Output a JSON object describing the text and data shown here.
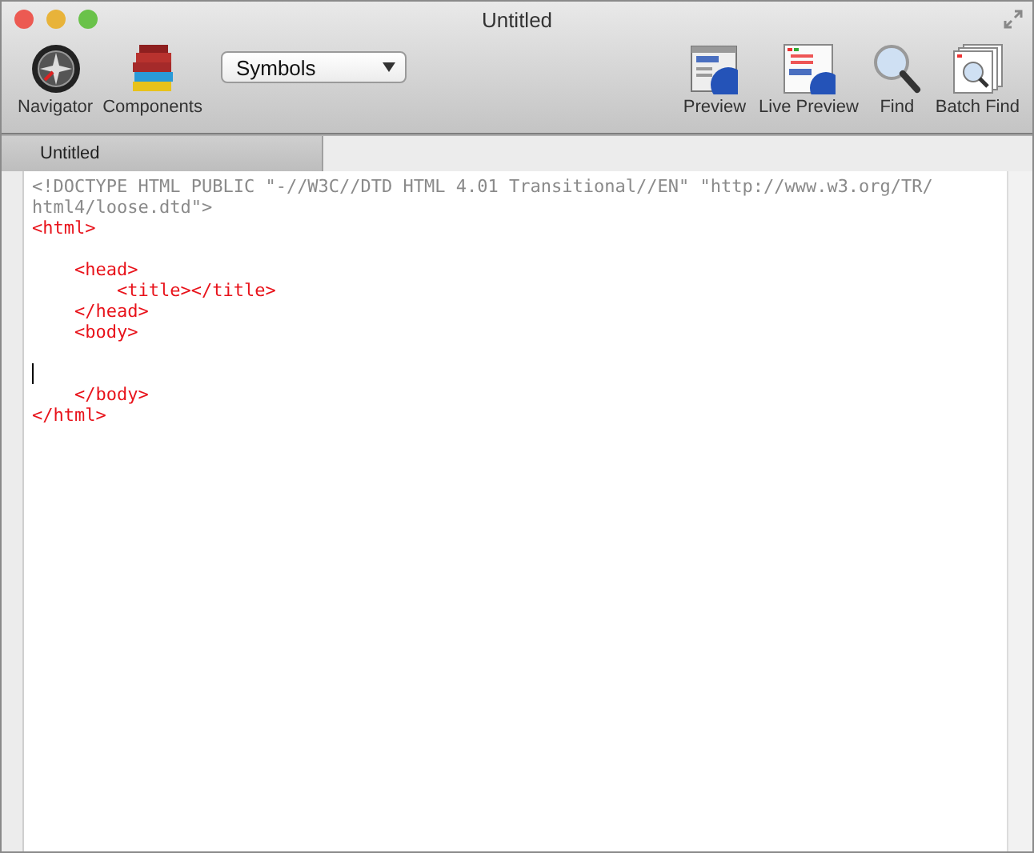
{
  "window": {
    "title": "Untitled"
  },
  "toolbar": {
    "left": [
      {
        "label": "Navigator",
        "kind": "compass"
      },
      {
        "label": "Components",
        "kind": "books"
      }
    ],
    "dropdown": {
      "value": "Symbols"
    },
    "right": [
      {
        "label": "Preview",
        "kind": "preview"
      },
      {
        "label": "Live Preview",
        "kind": "live"
      },
      {
        "label": "Find",
        "kind": "find"
      },
      {
        "label": "Batch Find",
        "kind": "batch"
      }
    ]
  },
  "tabs": [
    {
      "label": "Untitled",
      "selected": true
    }
  ],
  "editor": {
    "lines": [
      {
        "kind": "doctype",
        "text": "<!DOCTYPE HTML PUBLIC \"-//W3C//DTD HTML 4.01 Transitional//EN\" \"http://www.w3.org/TR/"
      },
      {
        "kind": "doctype",
        "text": "html4/loose.dtd\">"
      },
      {
        "kind": "tag",
        "text": "<html>"
      },
      {
        "kind": "blank"
      },
      {
        "kind": "tag",
        "text": "    <head>"
      },
      {
        "kind": "tag",
        "text": "        <title></title>"
      },
      {
        "kind": "tag",
        "text": "    </head>"
      },
      {
        "kind": "tag",
        "text": "    <body>"
      },
      {
        "kind": "blank"
      },
      {
        "kind": "cursor"
      },
      {
        "kind": "tag",
        "text": "    </body>"
      },
      {
        "kind": "tag",
        "text": "</html>"
      }
    ]
  }
}
